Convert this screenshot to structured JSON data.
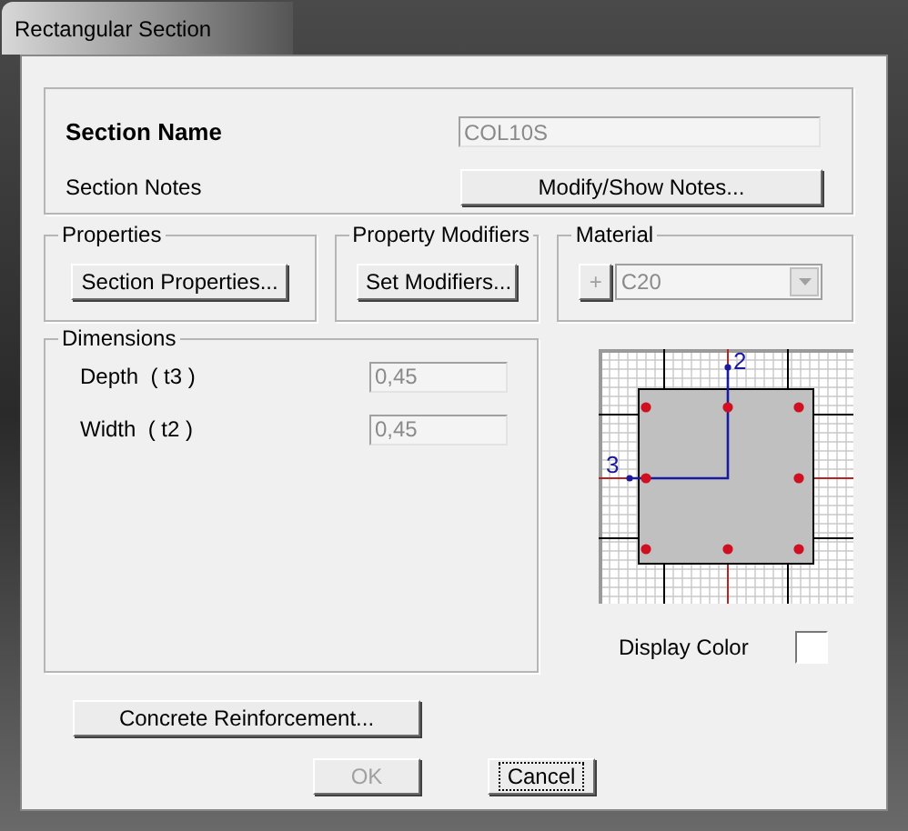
{
  "window": {
    "title": "Rectangular Section"
  },
  "section_name": {
    "label": "Section Name",
    "value": "COL10S",
    "disabled": true
  },
  "section_notes": {
    "label": "Section Notes",
    "button": "Modify/Show Notes..."
  },
  "properties": {
    "title": "Properties",
    "button": "Section Properties..."
  },
  "property_modifiers": {
    "title": "Property Modifiers",
    "button": "Set Modifiers..."
  },
  "material": {
    "title": "Material",
    "add_button": "+",
    "value": "C20",
    "disabled": true
  },
  "dimensions": {
    "title": "Dimensions",
    "fields": [
      {
        "label": "Depth  ( t3 )",
        "value": "0,45",
        "disabled": true
      },
      {
        "label": "Width  ( t2 )",
        "value": "0,45",
        "disabled": true
      }
    ]
  },
  "diagram": {
    "axis_vertical": "2",
    "axis_horizontal": "3"
  },
  "display_color": {
    "label": "Display Color",
    "color": "#ffffff"
  },
  "concrete_reinforcement": {
    "button": "Concrete Reinforcement..."
  },
  "buttons": [
    {
      "label": "OK",
      "disabled": true,
      "focused": false
    },
    {
      "label": "Cancel",
      "disabled": false,
      "focused": true
    }
  ]
}
